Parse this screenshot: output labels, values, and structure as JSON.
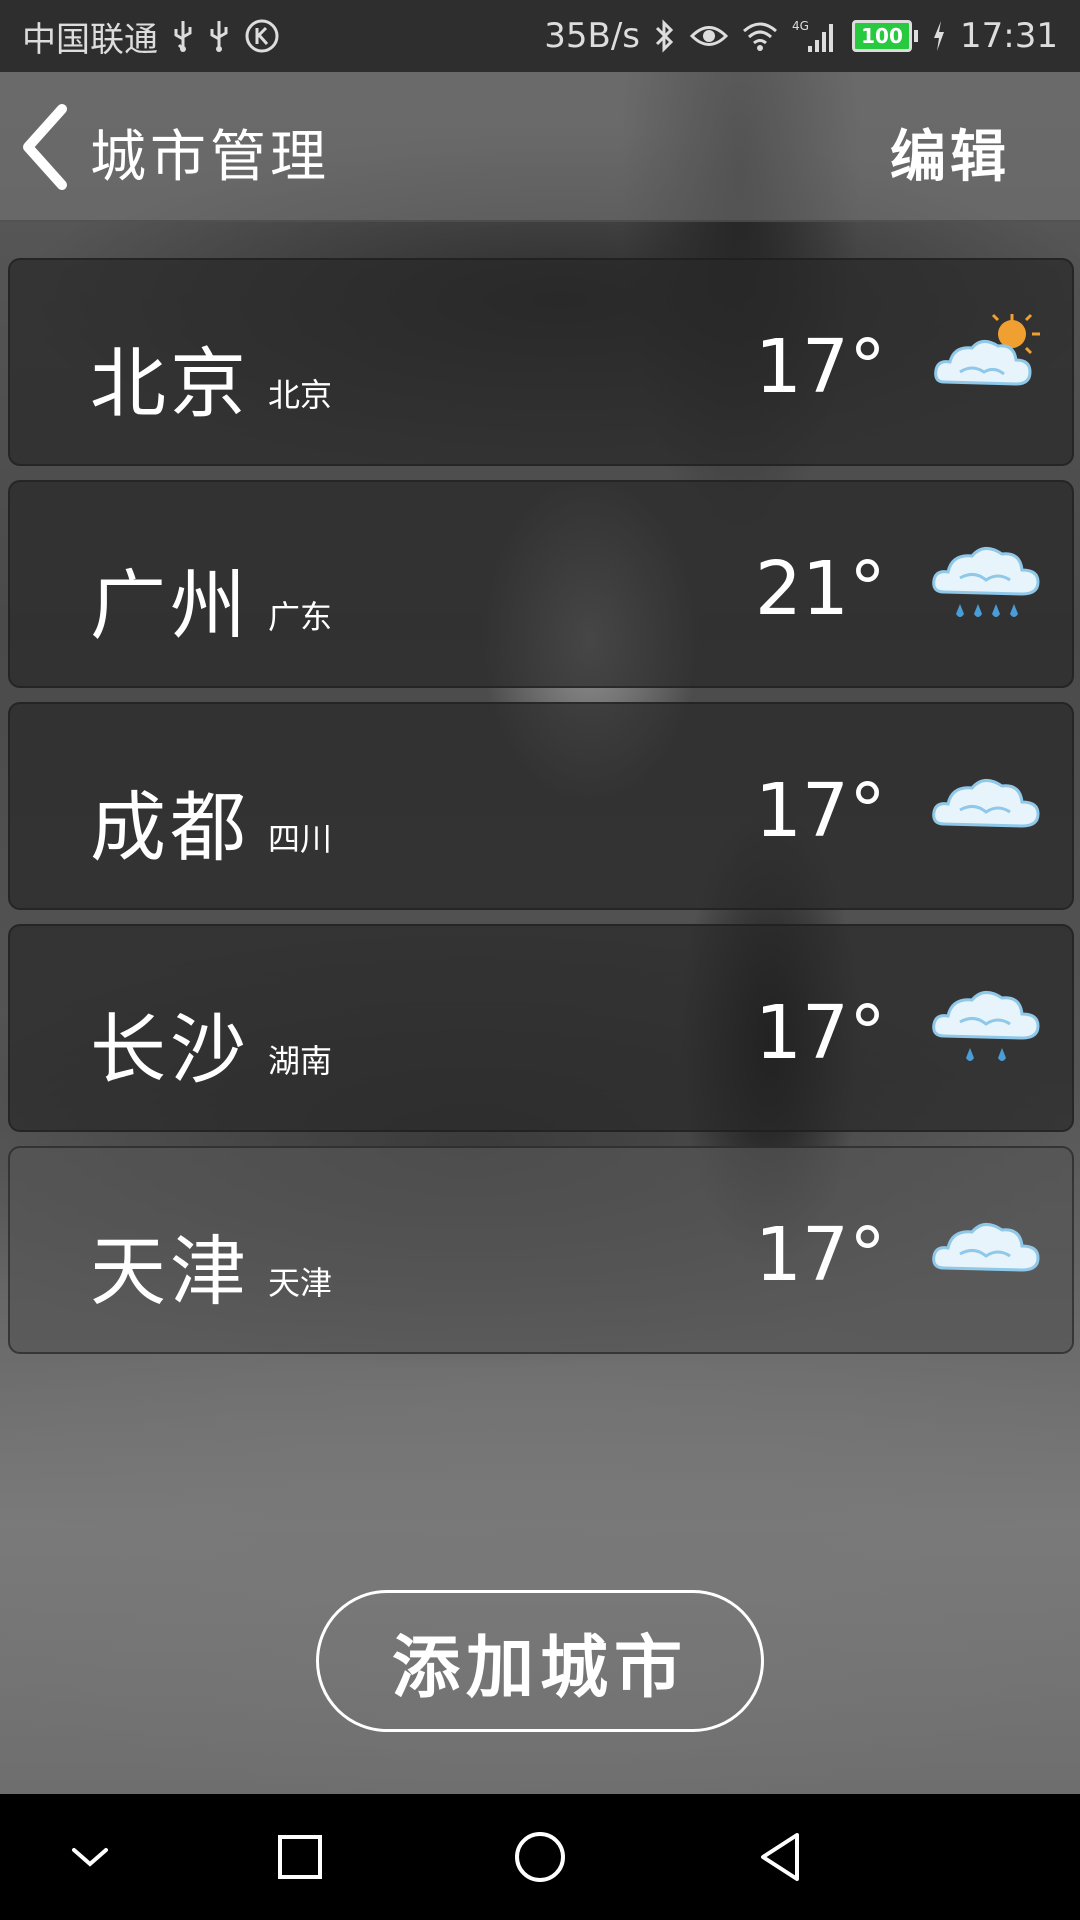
{
  "status_bar": {
    "carrier": "中国联通",
    "net_speed": "35B/s",
    "network_type": "4G",
    "battery_level": "100",
    "time": "17:31",
    "icons": [
      "usb-icon",
      "usb-icon",
      "k-circle-icon",
      "bluetooth-icon",
      "eye-icon",
      "wifi-icon",
      "signal-icon",
      "battery-icon",
      "charging-icon"
    ]
  },
  "header": {
    "title": "城市管理",
    "edit_label": "编辑",
    "back_icon": "chevron-left-icon"
  },
  "cities": [
    {
      "name": "北京",
      "province": "北京",
      "temp": "17°",
      "weather_icon": "partly-sunny-icon"
    },
    {
      "name": "广州",
      "province": "广东",
      "temp": "21°",
      "weather_icon": "heavy-rain-icon"
    },
    {
      "name": "成都",
      "province": "四川",
      "temp": "17°",
      "weather_icon": "cloudy-icon"
    },
    {
      "name": "长沙",
      "province": "湖南",
      "temp": "17°",
      "weather_icon": "light-rain-icon"
    },
    {
      "name": "天津",
      "province": "天津",
      "temp": "17°",
      "weather_icon": "cloudy-icon"
    }
  ],
  "add_city_label": "添加城市",
  "nav": {
    "icons": [
      "collapse-icon",
      "recents-icon",
      "home-icon",
      "back-icon"
    ]
  },
  "colors": {
    "battery": "#27c93f",
    "sun": "#f0a030",
    "cloud": "#e8f4fb",
    "cloud_shade": "#8fc8e8",
    "rain": "#4a9ed8"
  }
}
